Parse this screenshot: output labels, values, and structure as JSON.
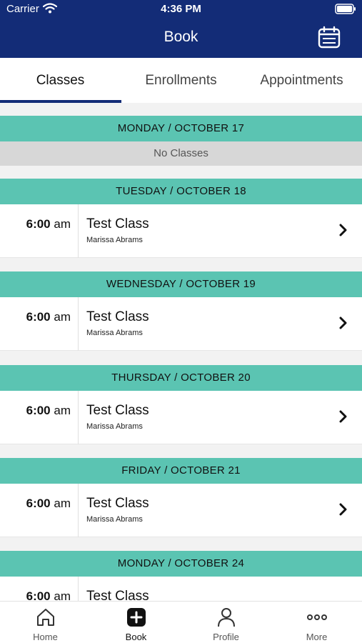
{
  "status_bar": {
    "carrier": "Carrier",
    "time": "4:36 PM"
  },
  "header": {
    "title": "Book",
    "calendar_icon": "calendar-icon"
  },
  "tabs": [
    {
      "label": "Classes",
      "active": true
    },
    {
      "label": "Enrollments",
      "active": false
    },
    {
      "label": "Appointments",
      "active": false
    }
  ],
  "schedule": [
    {
      "day": "MONDAY / OCTOBER 17",
      "empty_text": "No Classes",
      "classes": []
    },
    {
      "day": "TUESDAY / OCTOBER 18",
      "classes": [
        {
          "time": "6:00",
          "ampm": "am",
          "name": "Test Class",
          "instructor": "Marissa Abrams"
        }
      ]
    },
    {
      "day": "WEDNESDAY / OCTOBER 19",
      "classes": [
        {
          "time": "6:00",
          "ampm": "am",
          "name": "Test Class",
          "instructor": "Marissa Abrams"
        }
      ]
    },
    {
      "day": "THURSDAY / OCTOBER 20",
      "classes": [
        {
          "time": "6:00",
          "ampm": "am",
          "name": "Test Class",
          "instructor": "Marissa Abrams"
        }
      ]
    },
    {
      "day": "FRIDAY / OCTOBER 21",
      "classes": [
        {
          "time": "6:00",
          "ampm": "am",
          "name": "Test Class",
          "instructor": "Marissa Abrams"
        }
      ]
    },
    {
      "day": "MONDAY / OCTOBER 24",
      "classes": [
        {
          "time": "6:00",
          "ampm": "am",
          "name": "Test Class",
          "instructor": ""
        }
      ]
    }
  ],
  "tab_bar": [
    {
      "label": "Home",
      "icon": "home-icon",
      "active": false
    },
    {
      "label": "Book",
      "icon": "add-icon",
      "active": true
    },
    {
      "label": "Profile",
      "icon": "profile-icon",
      "active": false
    },
    {
      "label": "More",
      "icon": "more-icon",
      "active": false
    }
  ],
  "colors": {
    "nav": "#132c77",
    "day_header": "#5bc4b2",
    "no_classes": "#d7d7d7"
  }
}
